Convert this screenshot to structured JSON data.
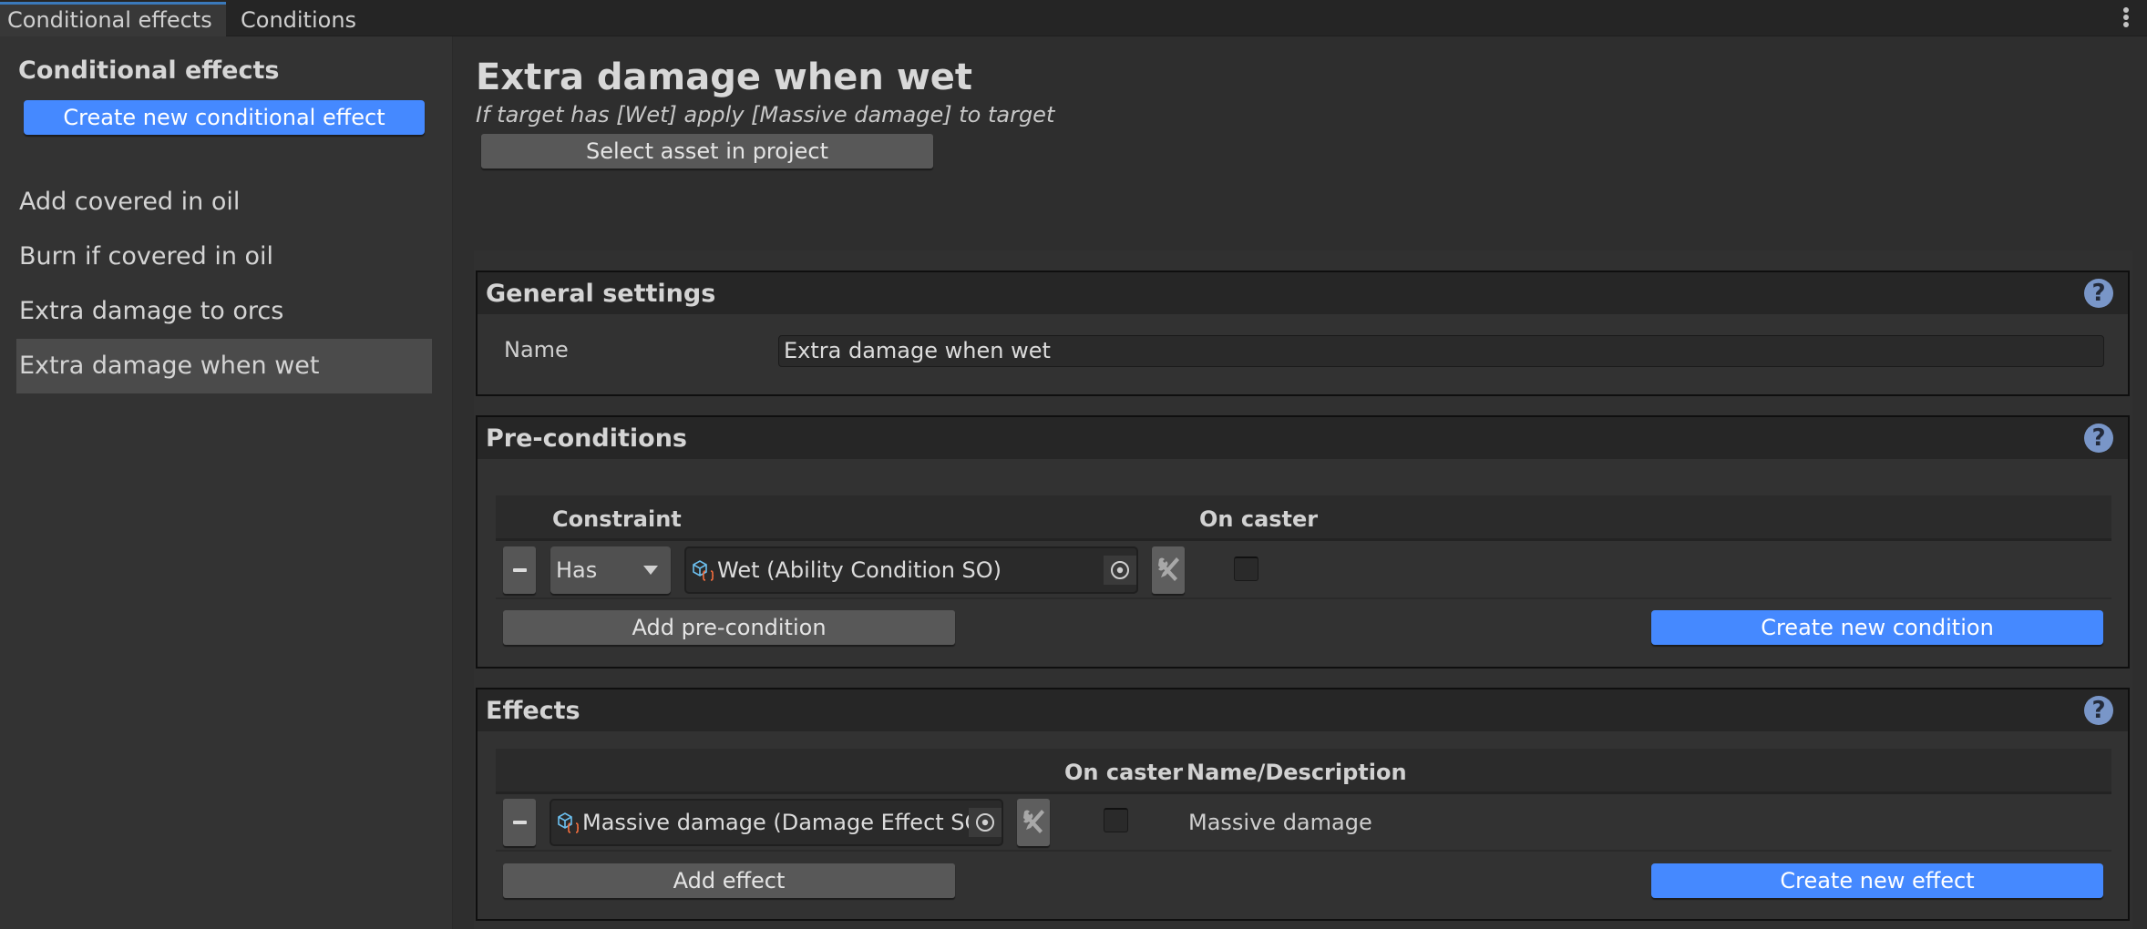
{
  "tabs": [
    {
      "label": "Conditional effects",
      "active": true
    },
    {
      "label": "Conditions",
      "active": false
    }
  ],
  "sidebar": {
    "title": "Conditional effects",
    "create_button": "Create new conditional effect",
    "items": [
      {
        "label": "Add covered in oil",
        "selected": false
      },
      {
        "label": "Burn if covered in oil",
        "selected": false
      },
      {
        "label": "Extra damage to orcs",
        "selected": false
      },
      {
        "label": "Extra damage when wet",
        "selected": true
      }
    ]
  },
  "main": {
    "title": "Extra damage when wet",
    "subtitle": "If target has [Wet] apply [Massive damage] to target",
    "select_asset_button": "Select asset in project",
    "general": {
      "title": "General settings",
      "name_label": "Name",
      "name_value": "Extra damage when wet"
    },
    "preconditions": {
      "title": "Pre-conditions",
      "columns": [
        "Constraint",
        "On caster"
      ],
      "rows": [
        {
          "constraint": "Has",
          "asset": "Wet (Ability Condition SO)",
          "on_caster": false
        }
      ],
      "add_button": "Add pre-condition",
      "create_button": "Create new condition"
    },
    "effects": {
      "title": "Effects",
      "columns": [
        "On caster",
        "Name/Description"
      ],
      "rows": [
        {
          "asset": "Massive damage (Damage Effect SO)",
          "on_caster": false,
          "description": "Massive damage"
        }
      ],
      "add_button": "Add effect",
      "create_button": "Create new effect"
    },
    "help_symbol": "?"
  },
  "colors": {
    "accent_blue": "#4589ff",
    "tab_highlight": "#3a79bb",
    "help_icon": "#7996c8",
    "script_icon_blue": "#6cc0f0",
    "script_icon_orange": "#f26d3d"
  }
}
